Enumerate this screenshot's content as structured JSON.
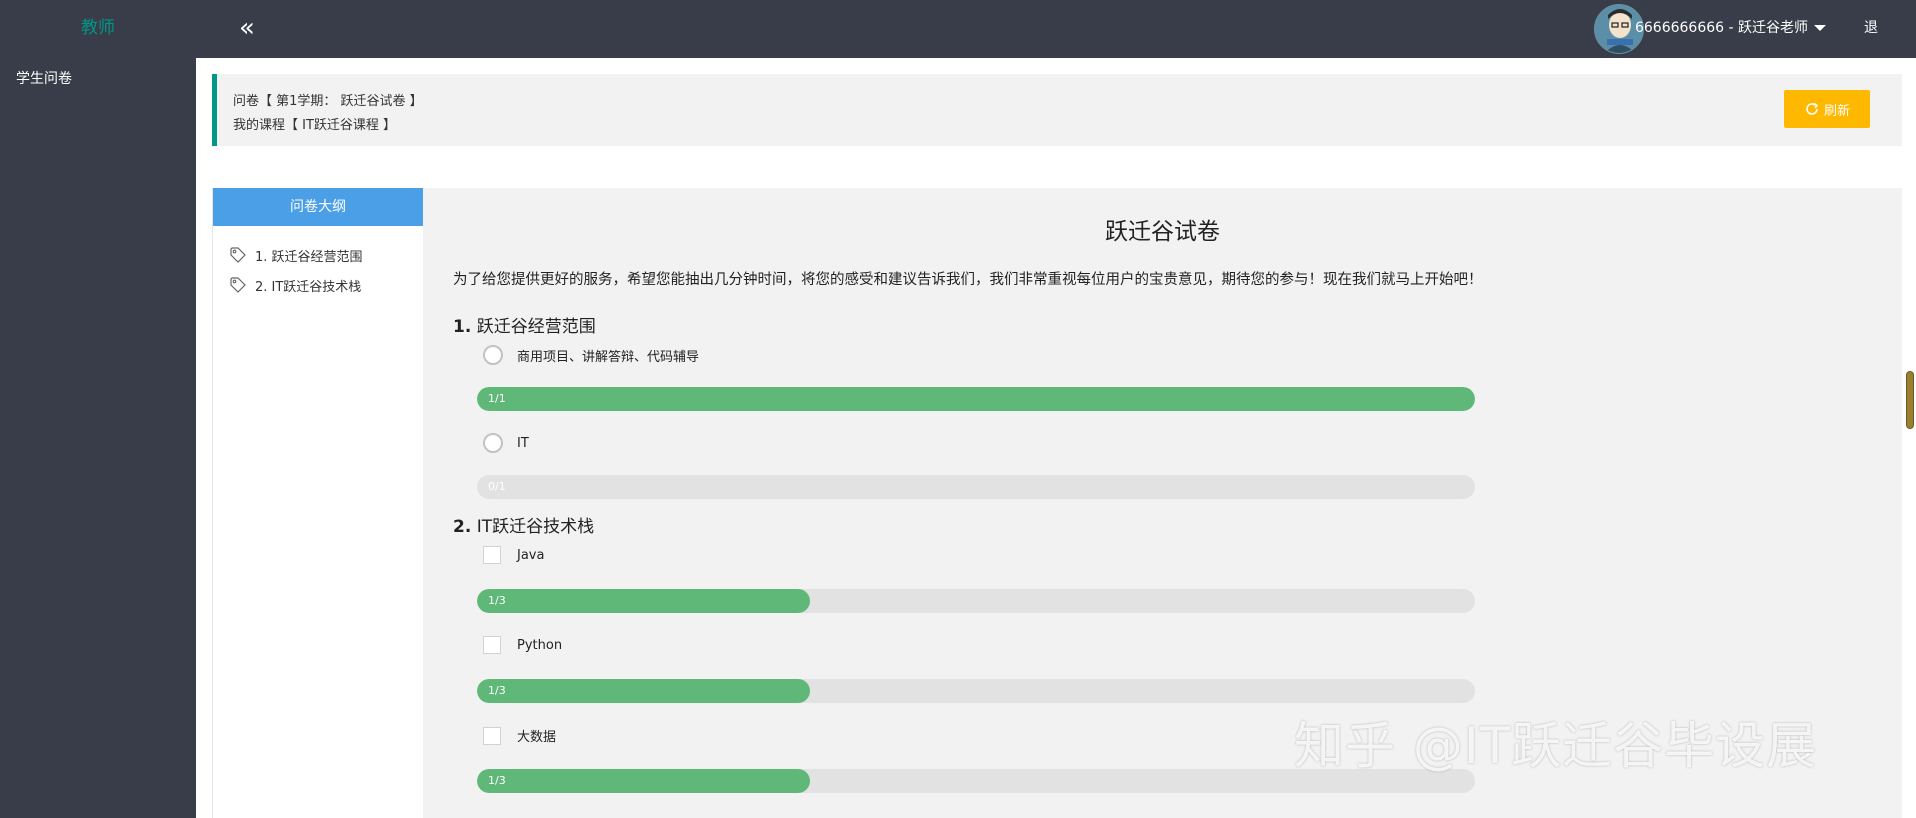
{
  "header": {
    "brand": "教师",
    "collapse_icon": "double-chevron-left-icon",
    "collapse_glyph": "«",
    "user_name": "6666666666 - 跃迁谷老师",
    "logout_label": "退出"
  },
  "sidebar": {
    "items": [
      {
        "label": "学生问卷"
      }
    ]
  },
  "info": {
    "line1": "问卷【 第1学期： 跃迁谷试卷 】",
    "line2": "我的课程【 IT跃迁谷课程 】",
    "refresh_label": "刷新"
  },
  "outline": {
    "title": "问卷大纲",
    "items": [
      {
        "label": "1. 跃迁谷经营范围"
      },
      {
        "label": "2. IT跃迁谷技术栈"
      }
    ]
  },
  "survey": {
    "title": "跃迁谷试卷",
    "description": "为了给您提供更好的服务，希望您能抽出几分钟时间，将您的感受和建议告诉我们，我们非常重视每位用户的宝贵意见，期待您的参与！现在我们就马上开始吧！",
    "questions": [
      {
        "number": "1.",
        "title": "跃迁谷经营范围",
        "type": "radio",
        "options": [
          {
            "label": "商用项目、讲解答辩、代码辅导",
            "count": "1/1",
            "fraction": 1.0
          },
          {
            "label": "IT",
            "count": "0/1",
            "fraction": 0.0
          }
        ]
      },
      {
        "number": "2.",
        "title": "IT跃迁谷技术栈",
        "type": "checkbox",
        "options": [
          {
            "label": "Java",
            "count": "1/3",
            "fraction": 0.3333
          },
          {
            "label": "Python",
            "count": "1/3",
            "fraction": 0.3333
          },
          {
            "label": "大数据",
            "count": "1/3",
            "fraction": 0.3333
          }
        ]
      }
    ]
  },
  "watermark": "知乎 @IT跃迁谷毕设展",
  "colors": {
    "header_bg": "#393d49",
    "brand": "#009688",
    "outline_head": "#4a9fe7",
    "refresh": "#ffb800",
    "progress_fill": "#5fb878",
    "progress_track": "#e2e2e2"
  }
}
